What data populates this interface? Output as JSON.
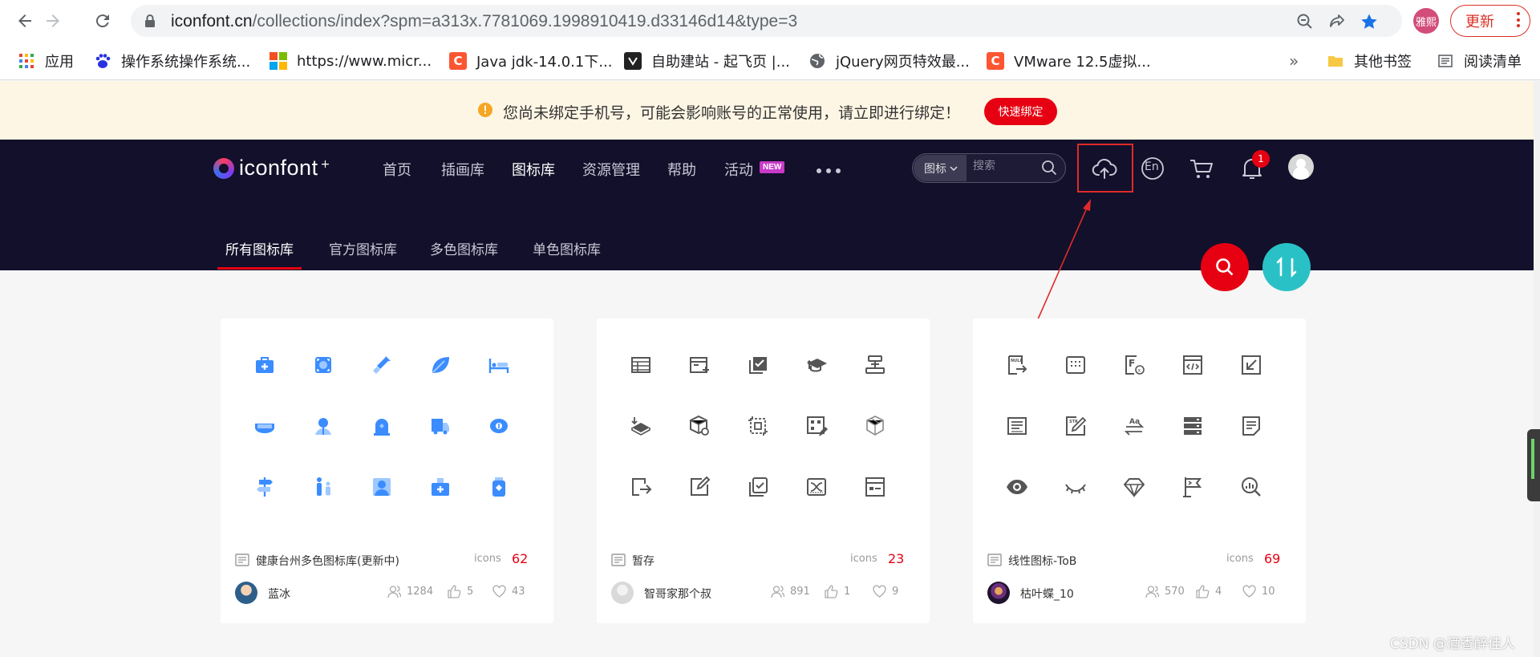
{
  "browser": {
    "url_host": "iconfont.cn",
    "url_rest": "/collections/index?spm=a313x.7781069.1998910419.d33146d14&type=3",
    "profile_label": "雅熙",
    "update_label": "更新"
  },
  "bookmarks": [
    {
      "label": "应用",
      "icon": "apps-grid-icon"
    },
    {
      "label": "操作系统操作系统...",
      "icon": "baidu-paw-icon"
    },
    {
      "label": "https://www.micr...",
      "icon": "microsoft-logo-icon"
    },
    {
      "label": "Java jdk-14.0.1下...",
      "icon": "csdn-c-icon"
    },
    {
      "label": "自助建站 - 起飞页 |...",
      "icon": "qifeiye-icon"
    },
    {
      "label": "jQuery网页特效最...",
      "icon": "globe-icon"
    },
    {
      "label": "VMware 12.5虚拟...",
      "icon": "csdn-c-icon"
    }
  ],
  "bookmarks_more": "»",
  "bookmarks_other": "其他书签",
  "bookmarks_reading": "阅读清单",
  "notice": {
    "text": "您尚未绑定手机号，可能会影响账号的正常使用，请立即进行绑定！",
    "button": "快速绑定"
  },
  "site": {
    "logo_text": "iconfont",
    "logo_sup": "+",
    "nav": [
      "首页",
      "插画库",
      "图标库",
      "资源管理",
      "帮助",
      "活动"
    ],
    "nav_badge": "NEW",
    "search_type": "图标",
    "search_placeholder": "搜索",
    "lang_label": "En",
    "notif_count": "1",
    "subnav": [
      "所有图标库",
      "官方图标库",
      "多色图标库",
      "单色图标库"
    ]
  },
  "icons_label": "icons",
  "cards": [
    {
      "name": "健康台州多色图标库(更新中)",
      "count": "62",
      "author": "蓝冰",
      "followers": "1284",
      "likes": "5",
      "favorites": "43",
      "style": "blue",
      "icons": [
        "medical-kit-icon",
        "scan-frame-icon",
        "syringe-icon",
        "leaf-icon",
        "hospital-bed-icon",
        "mask-icon",
        "tooth-icon",
        "tombstone-icon",
        "ambulance-icon",
        "piggy-bank-icon",
        "signpost-icon",
        "parent-child-icon",
        "user-portrait-icon",
        "medicine-box-icon",
        "medicine-bottle-icon"
      ]
    },
    {
      "name": "暂存",
      "count": "23",
      "author": "智哥家那个叔",
      "followers": "891",
      "likes": "1",
      "favorites": "9",
      "style": "gray",
      "icons": [
        "table-layout-icon",
        "card-add-icon",
        "checkbox-icon",
        "graduation-cap-icon",
        "align-center-icon",
        "layers-down-icon",
        "cube-settings-icon",
        "crop-icon",
        "qr-edit-icon",
        "cube-outline-icon",
        "file-export-icon",
        "edit-box-icon",
        "check-badge-icon",
        "shuffle-box-icon",
        "form-panel-icon"
      ]
    },
    {
      "name": "线性图标-ToB",
      "count": "69",
      "author": "枯叶蝶_10",
      "followers": "570",
      "likes": "4",
      "favorites": "10",
      "style": "gray",
      "icons": [
        "null-export-icon",
        "keyboard-icon",
        "function-icon",
        "code-window-icon",
        "arrow-down-left-icon",
        "text-block-icon",
        "text-edit-icon",
        "translate-icon",
        "server-icon",
        "document-icon",
        "eye-icon",
        "eye-closed-icon",
        "diamond-icon",
        "flag-icon",
        "analytics-search-icon"
      ]
    }
  ],
  "watermark": "CSDN @酒香醉佳人"
}
